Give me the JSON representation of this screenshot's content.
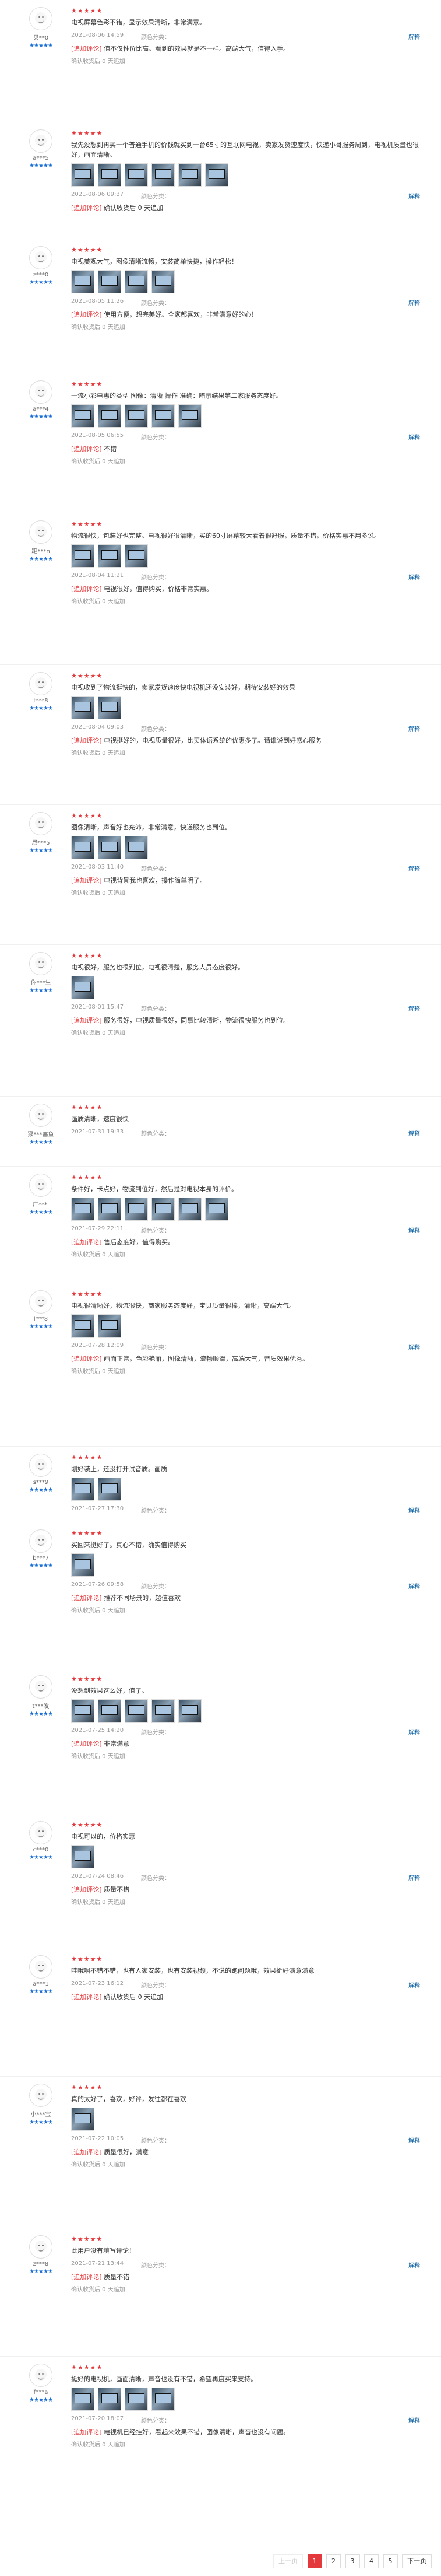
{
  "reviews": [
    {
      "user": "贝**0",
      "level": "★★★★★",
      "date": "2021-08-06 14:59",
      "spec": "颜色分类：",
      "stars": "★★★★★",
      "text": "电视屏幕色彩不错，显示效果清晰，非常满意。",
      "append_tag": "[追加评论]",
      "append": "值不仅性价比高。看到的效果就是不一样。高端大气，值得入手。",
      "thumbs": 0,
      "footer": "确认收货后 0 天追加"
    },
    {
      "user": "a***5",
      "level": "★★★★★",
      "date": "2021-08-06 09:37",
      "spec": "颜色分类：",
      "stars": "★★★★★",
      "text": "我先没想到再买一个普通手机的价钱就买到一台65寸的互联网电视，卖家发货速度快，快递小哥服务周到，电视机质量也很好，画面清晰。",
      "append_tag": "[追加评论]",
      "append": "确认收货后 0 天追加",
      "thumbs": 6,
      "footer": ""
    },
    {
      "user": "z***0",
      "level": "★★★★★",
      "date": "2021-08-05 11:26",
      "spec": "颜色分类：",
      "stars": "★★★★★",
      "text": "电视美观大气，图像清晰流畅，安装简单快捷，操作轻松！",
      "append_tag": "[追加评论]",
      "append": "使用方便，想完美好。全家都喜欢，非常满意好的心！",
      "thumbs": 4,
      "footer": "确认收货后 0 天追加"
    },
    {
      "user": "a***4",
      "level": "★★★★★",
      "date": "2021-08-05 06:55",
      "spec": "颜色分类：",
      "stars": "★★★★★",
      "text": "一流小彩电惠的类型 图像：清晰 操作 准确：暗示结果第二家服务态度好。",
      "append_tag": "[追加评论]",
      "append": "不错",
      "thumbs": 5,
      "footer": "确认收货后 0 天追加"
    },
    {
      "user": "跑***n",
      "level": "★★★★★",
      "date": "2021-08-04 11:21",
      "spec": "颜色分类：",
      "stars": "★★★★★",
      "text": "物流很快，包装好也完整。电视很好很清晰，买的60寸屏幕较大看着很舒服，质量不错，价格实惠不用多说。",
      "append_tag": "[追加评论]",
      "append": "电视很好，值得购买，价格非常实惠。",
      "thumbs": 3,
      "footer": "确认收货后 0 天追加"
    },
    {
      "user": "t***8",
      "level": "★★★★★",
      "date": "2021-08-04 09:03",
      "spec": "颜色分类：",
      "stars": "★★★★★",
      "text": "电视收到了物流挺快的，卖家发货速度快电视机还没安装好，期待安装好的效果",
      "append_tag": "[追加评论]",
      "append": "电视挺好的，电视质量很好，比买体语系统的优惠多了。请谁说到好感心服务",
      "thumbs": 2,
      "footer": "确认收货后 0 天追加"
    },
    {
      "user": "尼***5",
      "level": "★★★★★",
      "date": "2021-08-03 11:40",
      "spec": "颜色分类：",
      "stars": "★★★★★",
      "text": "图像清晰，声音好也充沛，非常满意，快递服务也到位。",
      "append_tag": "[追加评论]",
      "append": "电视背景我也喜欢，操作简单明了。",
      "thumbs": 3,
      "footer": "确认收货后 0 天追加"
    },
    {
      "user": "你***生",
      "level": "★★★★★",
      "date": "2021-08-01 15:47",
      "spec": "颜色分类：",
      "stars": "★★★★★",
      "text": "电视很好，服务也很到位，电视很清楚，服务人员态度很好。",
      "append_tag": "[追加评论]",
      "append": "服务很好，电视质量很好，同事比较清晰，物流很快服务也到位。",
      "thumbs": 1,
      "footer": "确认收货后 0 天追加"
    },
    {
      "user": "猴***塞鱼",
      "level": "★★★★★",
      "date": "2021-07-31 19:33",
      "spec": "颜色分类：",
      "stars": "★★★★★",
      "text": "画质清晰，速度很快",
      "append_tag": "",
      "append": "",
      "thumbs": 0,
      "footer": ""
    },
    {
      "user": "广***l",
      "level": "★★★★★",
      "date": "2021-07-29 22:11",
      "spec": "颜色分类：",
      "stars": "★★★★★",
      "text": "条件好，卡点好，物流到位好，然后是对电视本身的评价。",
      "append_tag": "[追加评论]",
      "append": "售后态度好，值得购买。",
      "thumbs": 6,
      "footer": "确认收货后 0 天追加"
    },
    {
      "user": "l***8",
      "level": "★★★★★",
      "date": "2021-07-28 12:09",
      "spec": "颜色分类：",
      "stars": "★★★★★",
      "text": "电视很清晰好，物流很快，商家服务态度好，宝贝质量很棒，清晰，高端大气。",
      "append_tag": "[追加评论]",
      "append": "画面正常，色彩艳丽，图像清晰，流畅顺滑，高端大气，音质效果优秀。",
      "thumbs": 2,
      "footer": "确认收货后 0 天追加"
    },
    {
      "user": "s***9",
      "level": "★★★★★",
      "date": "2021-07-27 17:30",
      "spec": "颜色分类：",
      "stars": "★★★★★",
      "text": "刚好装上，还没打开试音质。画质",
      "append_tag": "",
      "append": "",
      "thumbs": 2,
      "footer": ""
    },
    {
      "user": "b***7",
      "level": "★★★★★",
      "date": "2021-07-26 09:58",
      "spec": "颜色分类：",
      "stars": "★★★★★",
      "text": "买回来挺好了。真心不错，确实值得购买",
      "append_tag": "[追加评论]",
      "append": "推荐不同场景的，超值喜欢",
      "thumbs": 1,
      "footer": "确认收货后 0 天追加"
    },
    {
      "user": "t***发",
      "level": "★★★★★",
      "date": "2021-07-25 14:20",
      "spec": "颜色分类：",
      "stars": "★★★★★",
      "text": "没想到效果这么好，值了。",
      "append_tag": "[追加评论]",
      "append": "非常满意",
      "thumbs": 5,
      "footer": "确认收货后 0 天追加"
    },
    {
      "user": "c***0",
      "level": "★★★★★",
      "date": "2021-07-24 08:46",
      "spec": "颜色分类：",
      "stars": "★★★★★",
      "text": "电视可以的，价格实惠",
      "append_tag": "[追加评论]",
      "append": "质量不错",
      "thumbs": 1,
      "footer": "确认收货后 0 天追加"
    },
    {
      "user": "a***1",
      "level": "★★★★★",
      "date": "2021-07-23 16:12",
      "spec": "颜色分类：",
      "stars": "★★★★★",
      "text": "哇哦啊不错不错，也有人家安装，也有安装视频，不说的跑问题哦，效果挺好满意满意",
      "append_tag": "[追加评论]",
      "append": "确认收货后 0 天追加",
      "thumbs": 0,
      "footer": ""
    },
    {
      "user": "小***宝",
      "level": "★★★★★",
      "date": "2021-07-22 10:05",
      "spec": "颜色分类：",
      "stars": "★★★★★",
      "text": "真的太好了，喜欢，好评，发往都在喜欢",
      "append_tag": "[追加评论]",
      "append": "质量很好，满意",
      "thumbs": 1,
      "footer": "确认收货后 0 天追加"
    },
    {
      "user": "z***8",
      "level": "★★★★★",
      "date": "2021-07-21 13:44",
      "spec": "颜色分类：",
      "stars": "★★★★★",
      "text": "此用户没有填写评论！",
      "append_tag": "[追加评论]",
      "append": "质量不错",
      "thumbs": 0,
      "footer": "确认收货后 0 天追加"
    },
    {
      "user": "f***a",
      "level": "★★★★★",
      "date": "2021-07-20 18:07",
      "spec": "颜色分类：",
      "stars": "★★★★★",
      "text": "挺好的电视机，画面清晰，声音也没有不错，希望再度买来支持。",
      "append_tag": "[追加评论]",
      "append": "电视机已经挂好，看起来效果不错，图像清晰，声音也没有问题。",
      "thumbs": 4,
      "footer": "确认收货后 0 天追加"
    }
  ],
  "reply_label": "解释",
  "pager": {
    "prev": "上一页",
    "pages": [
      "1",
      "2",
      "3",
      "4",
      "5"
    ],
    "next": "下一页"
  }
}
